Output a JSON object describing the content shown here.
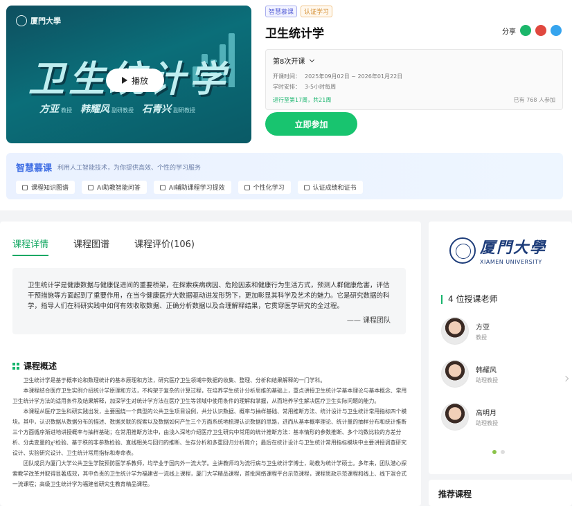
{
  "cover": {
    "university": "厦門大學",
    "title": "卫生统计学",
    "play_label": "播放",
    "teachers": [
      {
        "name": "方亚",
        "title": "教授"
      },
      {
        "name": "韩耀风",
        "title": "副研教授"
      },
      {
        "name": "石青兴",
        "title": "副研教授"
      }
    ]
  },
  "tags": [
    "智慧慕课",
    "认证学习"
  ],
  "course_title": "卫生统计学",
  "share_label": "分享",
  "share_icons": [
    "wechat-icon",
    "weibo-icon",
    "qq-icon"
  ],
  "session": {
    "selected": "第8次开课",
    "time_label": "开课时间：",
    "time_value": "2025年09月02日 ~ 2026年01月22日",
    "schedule_label": "学时安排：",
    "schedule_value": "3-5小时每周",
    "progress": "进行至第17周，共21周",
    "joined": "已有 768 人参加"
  },
  "join_label": "立即参加",
  "smart": {
    "brand": "智慧慕课",
    "desc": "利用人工智能技术，为你提供高效、个性的学习服务",
    "features": [
      "课程知识图谱",
      "AI助教智能问答",
      "AI辅助课程学习提效",
      "个性化学习",
      "认证成绩和证书"
    ]
  },
  "tabs": [
    "课程详情",
    "课程图谱",
    "课程评价(106)"
  ],
  "intro": {
    "text": "卫生统计学是健康数据与健康促进间的重要桥梁，在探索疾病病因、危险因素和健康行为生活方式，预测人群健康危害，评估干预措施等方面起到了重要作用，在当今健康医疗大数据驱动进发形势下，更加彰显其科学及艺术的魅力。它是研究数据的科学，指导人们在科研实践中如何有效收取数据、正确分析数据以及合理解释结果，它贯穿医学研究的全过程。",
    "signature": "—— 课程团队"
  },
  "overview": {
    "heading": "课程概述",
    "paragraphs": [
      "卫生统计学是基于概率论和数理统计的基本原理和方法，研究医疗卫生领域中数据的收集、整理、分析和结果解释的一门学科。",
      "本课程结合医疗卫生实例介绍统计学原理和方法，不构架于复杂的计算过程，在培养学生统计分析思维的基础上，重点讲授卫生统计学基本理论与基本概念、常用卫生统计学方法的适用条件及结果解释，加深学生对统计学方法在医疗卫生等领域中使用条件的理解和掌握，从而培养学生解决医疗卫生实际问题的能力。",
      "本课程从医疗卫生科研实践出发，主要围绕一个典型的公共卫生项目设例，共分认识数据、概率与抽样基础、常用推断方法、统计设计与卫生统计常用指标四个模块。其中，认识数据从数据分布的描述、数据关联的探索以及数据如何产生三个方面系统地梳理认识数据的思路，进而从基本概率理论、统计量的抽样分布和统计推断三个方面循序渐进地讲授概率与抽样基础；在常用推断方法中，由浅入深地介绍医疗卫生研究中常用的统计推断方法：基本情形的参数推断、多个均数比较的方差分析、分类变量的χ²检验、基于秩的非参数检验、直线相关与回归的推断、生存分析和多重回归分析简介；最后在统计设计与卫生统计常用指标模块中主要讲授调查研究设计、实验研究设计、卫生统计常用指标和寿命表。",
      "团队成员为厦门大学公共卫生学院预防医学系教师，均毕业于国内外一流大学。主讲教师均为流行病与卫生统计学博士，助教为统计学硕士。多年来，团队潜心探索教学改革并取得显著成效，其中负责的卫生统计学为福建省一流线上课程，厦门大学精品课程，首批网络课程平台示范课程，课程思政示范课程和线上、线下混合式一流课程；高级卫生统计学为福建省研究生教育精品课程。"
    ]
  },
  "side": {
    "uni_cn": "厦門大學",
    "uni_en": "XIAMEN UNIVERSITY",
    "teacher_count": "4 位授课老师",
    "teachers": [
      {
        "name": "方亚",
        "title": "教授"
      },
      {
        "name": "韩耀风",
        "title": "助理教授"
      },
      {
        "name": "高明月",
        "title": "助理教授"
      }
    ]
  },
  "recommend_title": "推荐课程"
}
